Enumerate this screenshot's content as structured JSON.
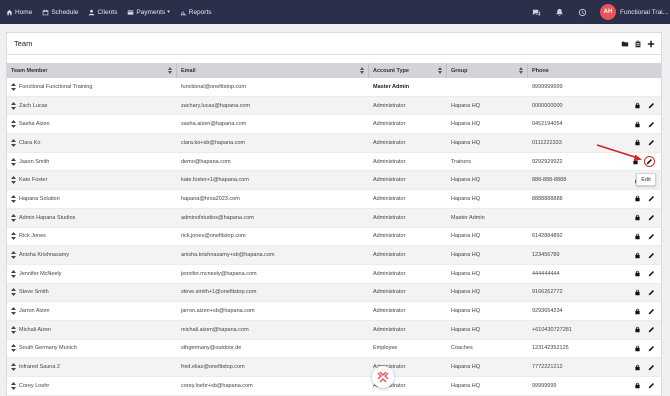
{
  "nav": {
    "items": [
      {
        "label": "Home",
        "icon": "home-icon"
      },
      {
        "label": "Schedule",
        "icon": "calendar-icon"
      },
      {
        "label": "Clients",
        "icon": "person-icon"
      },
      {
        "label": "Payments",
        "icon": "card-icon"
      },
      {
        "label": "Reports",
        "icon": "chart-icon"
      }
    ],
    "avatar_initials": "AH",
    "user_name": "Functional Trai..."
  },
  "panel": {
    "title": "Team"
  },
  "table": {
    "headers": [
      "Team Member",
      "Email",
      "Account Type",
      "Group",
      "Phone"
    ],
    "rows": [
      {
        "name": "Functional Functional Training",
        "email": "functional@onefitstop.com",
        "type": "Master Admin",
        "group": "",
        "phone": "9999999999",
        "actions": false
      },
      {
        "name": "Zach Lucas",
        "email": "zachary.lucas@hapana.com",
        "type": "Administrator",
        "group": "Hapana HQ",
        "phone": "0000000000",
        "actions": true
      },
      {
        "name": "Sasha Aizen",
        "email": "sasha.aizen@hapana.com",
        "type": "Administrator",
        "group": "Hapana HQ",
        "phone": "0452194054",
        "actions": true
      },
      {
        "name": "Clara Ko",
        "email": "clara.ko+sb@hapana.com",
        "type": "Administrator",
        "group": "Hapana HQ",
        "phone": "0111222333",
        "actions": true
      },
      {
        "name": "Jason Smith",
        "email": "demo@hapana.com",
        "type": "Administrator",
        "group": "Trainers",
        "phone": "9292929922",
        "actions": true
      },
      {
        "name": "Kate Foster",
        "email": "kate.foster+1@hapana.com",
        "type": "Administrator",
        "group": "Hapana HQ",
        "phone": "888-888-8888",
        "actions": true
      },
      {
        "name": "Hapana Solution",
        "email": "hapana@hrsa2023.com",
        "type": "Administrator",
        "group": "Hapana HQ",
        "phone": "8888888888",
        "actions": true
      },
      {
        "name": "Admin Hapana Studios",
        "email": "adminofstudios@hapana.com",
        "type": "Administrator",
        "group": "Master Admin",
        "phone": "",
        "actions": true
      },
      {
        "name": "Rick Jones",
        "email": "rick.jones@onefitstop.com",
        "type": "Administrator",
        "group": "Hapana HQ",
        "phone": "6142884892",
        "actions": true
      },
      {
        "name": "Anisha Krishnasamy",
        "email": "anisha.krishnasamy+sb@hapana.com",
        "type": "Administrator",
        "group": "Hapana HQ",
        "phone": "123456789",
        "actions": true
      },
      {
        "name": "Jennifer McNeely",
        "email": "jennifer.mcneely@hapana.com",
        "type": "Administrator",
        "group": "Hapana HQ",
        "phone": "444444444",
        "actions": true
      },
      {
        "name": "Steve Smith",
        "email": "steve.smith+1@onefitstop.com",
        "type": "Administrator",
        "group": "Hapana HQ",
        "phone": "9166262772",
        "actions": true
      },
      {
        "name": "Jarron Aizen",
        "email": "jarron.aizen+sb@hapana.com",
        "type": "Administrator",
        "group": "Hapana HQ",
        "phone": "9293654234",
        "actions": true
      },
      {
        "name": "Michali Aizen",
        "email": "michali.aizen@hapana.com",
        "type": "Administrator",
        "group": "Hapana HQ",
        "phone": "+610430727281",
        "actions": true
      },
      {
        "name": "South Germany Munich",
        "email": "sthgermany@outdoor.de",
        "type": "Employee",
        "group": "Coaches",
        "phone": "123142352125",
        "actions": true
      },
      {
        "name": "Infrared Sauna 2",
        "email": "fred.elias@onefitstop.com",
        "type": "Administrator",
        "group": "Hapana HQ",
        "phone": "7772221212",
        "actions": true
      },
      {
        "name": "Corey Loehr",
        "email": "corey.loehr+sb@hapana.com",
        "type": "Administrator",
        "group": "Hapana HQ",
        "phone": "99999999",
        "actions": true
      }
    ]
  },
  "tooltip": {
    "label": "Edit"
  },
  "colors": {
    "nav_bg": "#2c2f4a",
    "avatar": "#e8545a",
    "header_bg": "#d4d4d8",
    "annotation": "#d32626"
  }
}
